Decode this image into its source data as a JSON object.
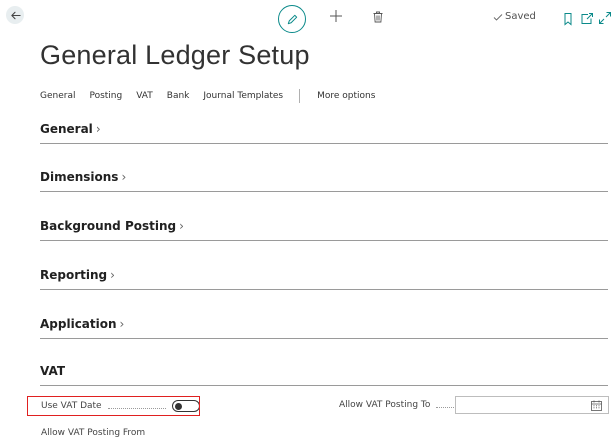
{
  "header": {
    "saved_label": "Saved",
    "title": "General Ledger Setup"
  },
  "actions": {
    "items": [
      "General",
      "Posting",
      "VAT",
      "Bank",
      "Journal Templates"
    ],
    "more": "More options"
  },
  "sections": {
    "general": "General",
    "dimensions": "Dimensions",
    "background": "Background Posting",
    "reporting": "Reporting",
    "application": "Application",
    "vat": "VAT"
  },
  "vat": {
    "use_vat_date_label": "Use VAT Date",
    "use_vat_date_value": false,
    "allow_from_label": "Allow VAT Posting From",
    "allow_from_value": "",
    "allow_to_label": "Allow VAT Posting To",
    "allow_to_value": ""
  },
  "colors": {
    "accent": "#0b8a8a",
    "highlight": "#e02020"
  }
}
